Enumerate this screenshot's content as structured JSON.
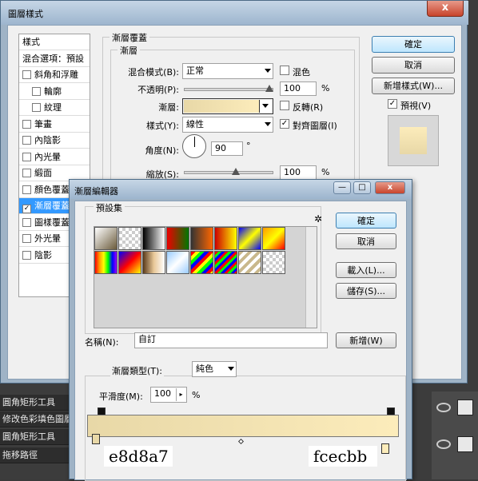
{
  "layer_style": {
    "title": "圖層樣式",
    "close_label": "x",
    "nav_items": [
      {
        "label": "樣式",
        "checkbox": false,
        "checked": false
      },
      {
        "label": "混合選項：預設",
        "checkbox": false,
        "checked": false
      },
      {
        "label": "斜角和浮雕",
        "checkbox": true,
        "checked": false
      },
      {
        "label": "輪廓",
        "checkbox": true,
        "checked": false
      },
      {
        "label": "紋理",
        "checkbox": true,
        "checked": false
      },
      {
        "label": "筆畫",
        "checkbox": true,
        "checked": false
      },
      {
        "label": "內陰影",
        "checkbox": true,
        "checked": false
      },
      {
        "label": "內光暈",
        "checkbox": true,
        "checked": false
      },
      {
        "label": "緞面",
        "checkbox": true,
        "checked": false
      },
      {
        "label": "顏色覆蓋",
        "checkbox": true,
        "checked": false
      },
      {
        "label": "漸層覆蓋",
        "checkbox": true,
        "checked": true
      },
      {
        "label": "圖樣覆蓋",
        "checkbox": true,
        "checked": false
      },
      {
        "label": "外光暈",
        "checkbox": true,
        "checked": false
      },
      {
        "label": "陰影",
        "checkbox": true,
        "checked": false
      }
    ],
    "group_title": "漸層覆蓋",
    "sub_group_title": "漸層",
    "blend_mode_label": "混合模式(B):",
    "blend_mode_value": "正常",
    "dither_label": "混色",
    "opacity_label": "不透明(P):",
    "opacity_value": "100",
    "opacity_unit": "%",
    "gradient_label": "漸層:",
    "reverse_label": "反轉(R)",
    "style_label": "樣式(Y):",
    "style_value": "線性",
    "align_label": "對齊圖層(I)",
    "angle_label": "角度(N):",
    "angle_value": "90",
    "angle_unit": "°",
    "scale_label": "縮放(S):",
    "scale_value": "100",
    "scale_unit": "%",
    "ok_label": "確定",
    "cancel_label": "取消",
    "new_style_label": "新增樣式(W)...",
    "preview_label": "預視(V)"
  },
  "gradient_editor": {
    "title": "漸層編輯器",
    "presets_label": "預設集",
    "ok_label": "確定",
    "cancel_label": "取消",
    "load_label": "載入(L)...",
    "save_label": "儲存(S)...",
    "name_label": "名稱(N):",
    "name_value": "自訂",
    "new_label": "新增(W)",
    "type_label": "漸層類型(T):",
    "type_value": "純色",
    "smoothness_label": "平滑度(M):",
    "smoothness_value": "100",
    "smoothness_unit": "%",
    "stop_left_label": "e8d8a7",
    "stop_right_label": "fcecbb"
  },
  "background_panel": {
    "items": [
      "圓角矩形工具",
      "修改色彩填色圖層",
      "圓角矩形工具",
      "拖移路徑"
    ]
  },
  "colors": {
    "gradient_start": "#e8d8a7",
    "gradient_end": "#fcecbb",
    "selection": "#3399ff"
  }
}
